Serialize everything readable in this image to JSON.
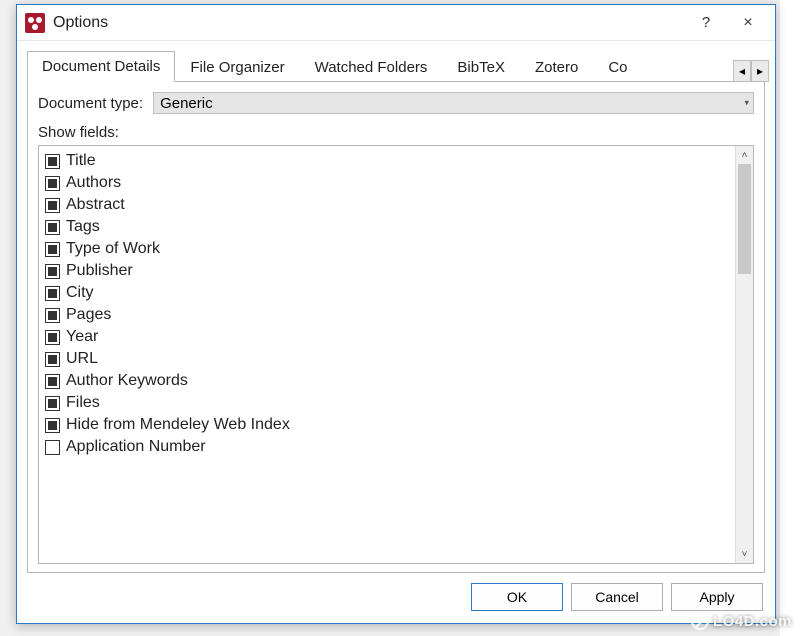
{
  "window": {
    "title": "Options",
    "help_tooltip": "?",
    "close_tooltip": "×"
  },
  "tabs": [
    {
      "label": "Document Details",
      "active": true
    },
    {
      "label": "File Organizer",
      "active": false
    },
    {
      "label": "Watched Folders",
      "active": false
    },
    {
      "label": "BibTeX",
      "active": false
    },
    {
      "label": "Zotero",
      "active": false
    },
    {
      "label": "Co",
      "active": false
    }
  ],
  "doc_type": {
    "label": "Document type:",
    "value": "Generic"
  },
  "show_fields_label": "Show fields:",
  "fields": [
    {
      "label": "Title",
      "checked": true
    },
    {
      "label": "Authors",
      "checked": true
    },
    {
      "label": "Abstract",
      "checked": true
    },
    {
      "label": "Tags",
      "checked": true
    },
    {
      "label": "Type of Work",
      "checked": true
    },
    {
      "label": "Publisher",
      "checked": true
    },
    {
      "label": "City",
      "checked": true
    },
    {
      "label": "Pages",
      "checked": true
    },
    {
      "label": "Year",
      "checked": true
    },
    {
      "label": "URL",
      "checked": true
    },
    {
      "label": "Author Keywords",
      "checked": true
    },
    {
      "label": "Files",
      "checked": true
    },
    {
      "label": "Hide from Mendeley Web Index",
      "checked": true
    },
    {
      "label": "Application Number",
      "checked": false
    }
  ],
  "buttons": {
    "ok": "OK",
    "cancel": "Cancel",
    "apply": "Apply"
  },
  "watermark": "LO4D.com"
}
